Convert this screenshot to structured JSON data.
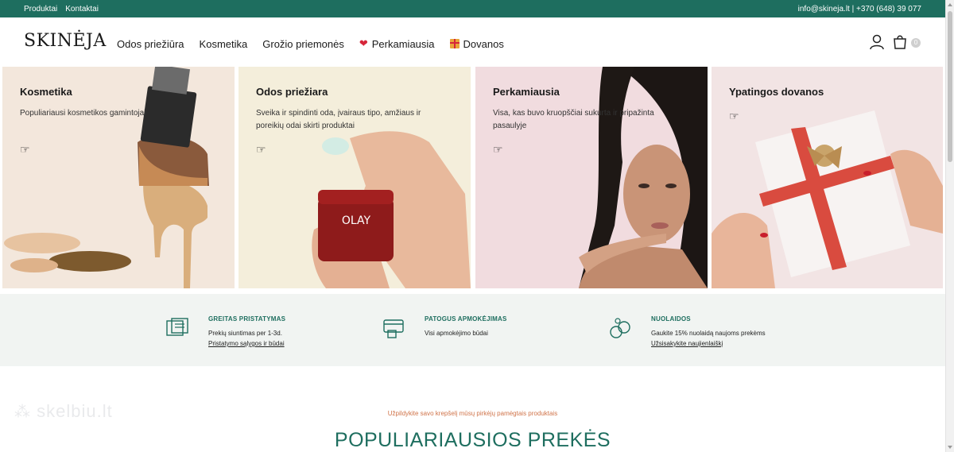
{
  "topbar": {
    "links": [
      "Produktai",
      "Kontaktai"
    ],
    "contact": "info@skineja.lt | +370 (648) 39 077"
  },
  "header": {
    "logo": "SKINĖJA",
    "nav": [
      {
        "label": "Odos priežiūra",
        "icon": ""
      },
      {
        "label": "Kosmetika",
        "icon": ""
      },
      {
        "label": "Grožio priemonės",
        "icon": ""
      },
      {
        "label": "Perkamiausia",
        "icon": "heart-icon"
      },
      {
        "label": "Dovanos",
        "icon": "gift-icon"
      }
    ],
    "cart_count": "0"
  },
  "banners": [
    {
      "title": "Kosmetika",
      "desc": "Populiariausi kosmetikos gamintojai",
      "icon": "pointing-hand-icon"
    },
    {
      "title": "Odos priežiara",
      "desc": "Sveika ir spindinti oda, įvairaus tipo, amžiaus ir poreikių odai skirti produktai",
      "icon": "pointing-hand-icon",
      "product_text": "OLAY"
    },
    {
      "title": "Perkamiausia",
      "desc": "Visa, kas buvo kruopščiai sukurta ir pripažinta pasaulyje",
      "icon": "pointing-hand-icon"
    },
    {
      "title": "Ypatingos dovanos",
      "desc": "",
      "icon": "pointing-hand-icon"
    }
  ],
  "features": [
    {
      "heading": "GREITAS PRISTATYMAS",
      "line": "Prekių siuntimas per 1-3d.",
      "link": "Pristatymo sąlygos ir būdai",
      "icon": "delivery-icon"
    },
    {
      "heading": "PATOGUS APMOKĖJIMAS",
      "line": "Visi apmokėjimo būdai",
      "link": "",
      "icon": "payment-icon"
    },
    {
      "heading": "NUOLAIDOS",
      "line": "Gaukite 15% nuolaidą naujoms prekėms",
      "link": "Užsisakykite naujienlaiškį",
      "icon": "discount-icon"
    }
  ],
  "watermark": "skelbiu.lt",
  "popular": {
    "subtitle": "Užpildykite savo krepšelį mūsų pirkėjų pamėgtais produktais",
    "title": "POPULIARIAUSIOS PREKĖS"
  },
  "colors": {
    "brand": "#1e6e5f",
    "accent": "#d0744a"
  }
}
